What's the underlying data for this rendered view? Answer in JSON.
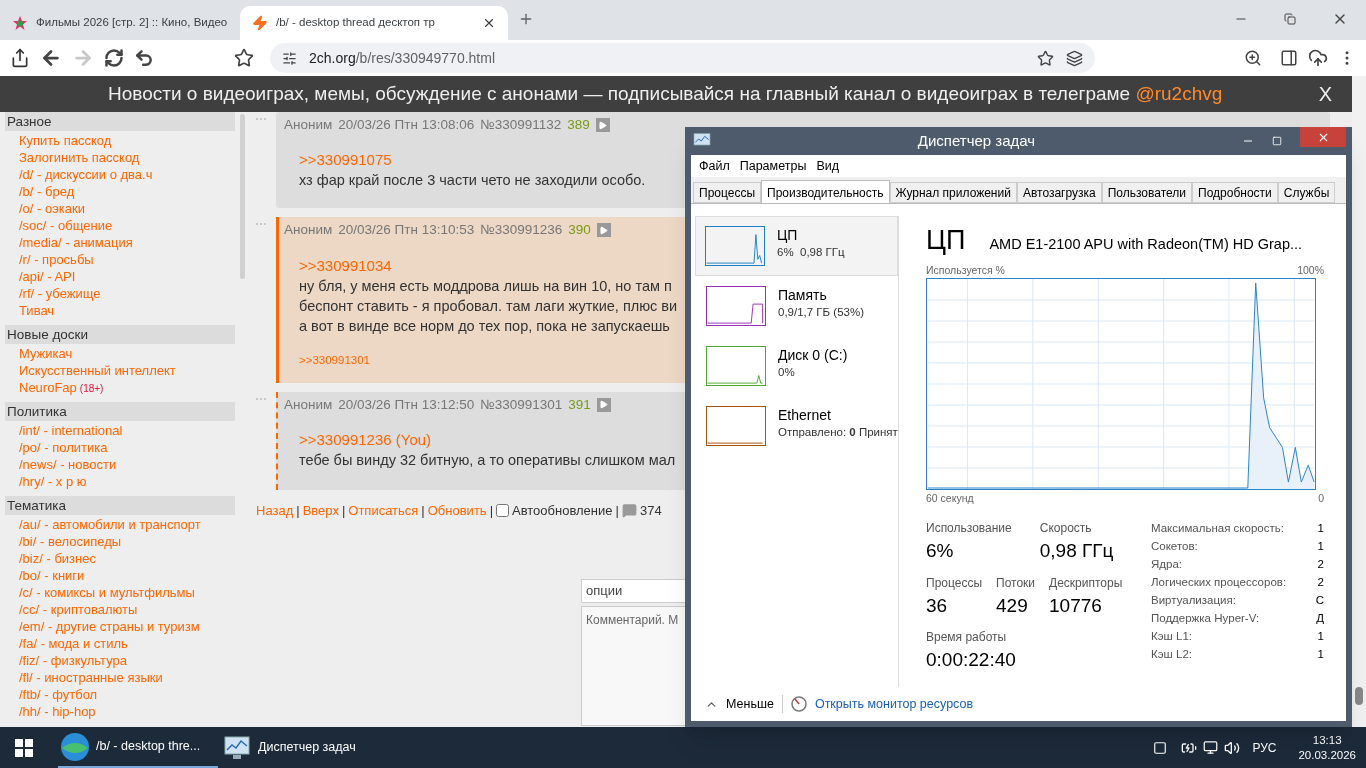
{
  "browser_tabs": [
    {
      "title": "Фильмы 2026 [стр. 2] :: Кино, Видео",
      "selected": false
    },
    {
      "title": "/b/ - desktop thread десктоп тр",
      "selected": true
    }
  ],
  "toolbar": {
    "forward_disabled": true,
    "url_host": "2ch.org",
    "url_path": "/b/res/330949770.html"
  },
  "banner": {
    "text": "Новости о видеоиграх, мемы, обсуждение с анонами — подписывайся на главный канал о видеоиграх в телеграме ",
    "channel": "@ru2chvg",
    "close": "X"
  },
  "sidebar": [
    {
      "title": "Разное",
      "items": [
        {
          "label": "Купить пасскод"
        },
        {
          "label": "Залогинить пасскод"
        },
        {
          "label": "/d/ - дискуссии о два.ч"
        },
        {
          "label": "/b/ - бред"
        },
        {
          "label": "/o/ - оэкаки"
        },
        {
          "label": "/soc/ - общение"
        },
        {
          "label": "/media/ - анимация"
        },
        {
          "label": "/r/ - просьбы"
        },
        {
          "label": "/api/ - API"
        },
        {
          "label": "/rf/ - убежище"
        },
        {
          "label": "Тивач"
        }
      ]
    },
    {
      "title": "Новые доски",
      "items": [
        {
          "label": "Мужикач"
        },
        {
          "label": "Искусственный интеллект"
        },
        {
          "label": "NeuroFap",
          "badge": "(18+)"
        }
      ]
    },
    {
      "title": "Политика",
      "items": [
        {
          "label": "/int/ - international"
        },
        {
          "label": "/po/ - политика"
        },
        {
          "label": "/news/ - новости"
        },
        {
          "label": "/hry/ - х р ю"
        }
      ]
    },
    {
      "title": "Тематика",
      "items": [
        {
          "label": "/au/ - автомобили и транспорт"
        },
        {
          "label": "/bi/ - велосипеды"
        },
        {
          "label": "/biz/ - бизнес"
        },
        {
          "label": "/bo/ - книги"
        },
        {
          "label": "/c/ - комиксы и мультфильмы"
        },
        {
          "label": "/cc/ - криптовалюты"
        },
        {
          "label": "/em/ - другие страны и туризм"
        },
        {
          "label": "/fa/ - мода и стиль"
        },
        {
          "label": "/fiz/ - физкультура"
        },
        {
          "label": "/fl/ - иностранные языки"
        },
        {
          "label": "/ftb/ - футбол"
        },
        {
          "label": "/hh/ - hip-hop"
        }
      ]
    }
  ],
  "posts": [
    {
      "kind": "normal",
      "author": "Аноним",
      "date": "20/03/26 Птн 13:08:06",
      "number": "№330991132",
      "index": "389",
      "reply_to": ">>330991075",
      "lines": [
        "хз фар край после 3 части чето не заходили особо."
      ]
    },
    {
      "kind": "highlighted",
      "author": "Аноним",
      "date": "20/03/26 Птн 13:10:53",
      "number": "№330991236",
      "index": "390",
      "reply_to": ">>330991034",
      "lines": [
        "ну бля, у меня есть моддрова лишь на вин 10, но там п",
        "беспонт ставить - я пробовал. там лаги жуткие, плюс ви",
        "а вот в винде все норм до тех пор, пока не запускаешь"
      ],
      "replies": [
        ">>330991301"
      ]
    },
    {
      "kind": "reply_to_you",
      "author": "Аноним",
      "date": "20/03/26 Птн 13:12:50",
      "number": "№330991301",
      "index": "391",
      "reply_to": ">>330991236 (You)",
      "lines": [
        "тебе бы винду 32 битную, а то оперативы слишком мал"
      ]
    }
  ],
  "thread_footer": {
    "links": [
      "Назад",
      "Вверх",
      "Отписаться",
      "Обновить"
    ],
    "separator": "|",
    "autoupdate": {
      "label": "Автообновление",
      "checked": false
    },
    "post_count": "374"
  },
  "reply_form": {
    "options_placeholder": "опции",
    "comment_placeholder": "Комментарий. М"
  },
  "task_manager": {
    "title": "Диспетчер задач",
    "menu": [
      "Файл",
      "Параметры",
      "Вид"
    ],
    "tabs": [
      {
        "label": "Процессы",
        "selected": false
      },
      {
        "label": "Производительность",
        "selected": true
      },
      {
        "label": "Журнал приложений",
        "selected": false
      },
      {
        "label": "Автозагрузка",
        "selected": false
      },
      {
        "label": "Пользователи",
        "selected": false
      },
      {
        "label": "Подробности",
        "selected": false
      },
      {
        "label": "Службы",
        "selected": false
      }
    ],
    "resources": [
      {
        "name": "ЦП",
        "detail": "6%  0,98 ГГц",
        "selected": true,
        "color": "#1e7fc4"
      },
      {
        "name": "Память",
        "detail": "0,9/1,7 ГБ (53%)",
        "selected": false,
        "color": "#9b2fb5"
      },
      {
        "name": "Диск 0 (C:)",
        "detail": "0%",
        "selected": false,
        "color": "#4da92f"
      },
      {
        "name": "Ethernet",
        "detail": "Отправлено: **0** Принят",
        "selected": false,
        "color": "#a7520f"
      }
    ],
    "heading": "ЦП",
    "cpu_model": "AMD E1-2100 APU with Radeon(TM) HD Grap...",
    "graph_label": "Используется %",
    "graph_max": "100%",
    "graph_time": "60 секунд",
    "graph_min": "0",
    "stats_row_1": [
      {
        "label": "Использование",
        "value": "6%"
      },
      {
        "label": "Скорость",
        "value": "0,98 ГГц"
      }
    ],
    "stats_row_2": [
      {
        "label": "Процессы",
        "value": "36"
      },
      {
        "label": "Потоки",
        "value": "429"
      },
      {
        "label": "Дескрипторы",
        "value": "10776"
      }
    ],
    "uptime": {
      "label": "Время работы",
      "value": "0:00:22:40"
    },
    "specs": [
      {
        "label": "Максимальная скорость:",
        "value": "1"
      },
      {
        "label": "Сокетов:",
        "value": "1"
      },
      {
        "label": "Ядра:",
        "value": "2"
      },
      {
        "label": "Логических процессоров:",
        "value": "2"
      },
      {
        "label": "Виртуализация:",
        "value": "С"
      },
      {
        "label": "Поддержка Hyper-V:",
        "value": "Д"
      },
      {
        "label": "Кэш L1:",
        "value": "1"
      },
      {
        "label": "Кэш L2:",
        "value": "1"
      }
    ],
    "fewer": "Меньше",
    "monitor_link": "Открыть монитор ресурсов"
  },
  "taskbar": {
    "tasks": [
      {
        "kind": "browser",
        "label": "/b/ - desktop thre..."
      },
      {
        "kind": "taskmgr",
        "label": "Диспетчер задач"
      }
    ],
    "language": "РУС",
    "time": "13:13",
    "date": "20.03.2026"
  }
}
